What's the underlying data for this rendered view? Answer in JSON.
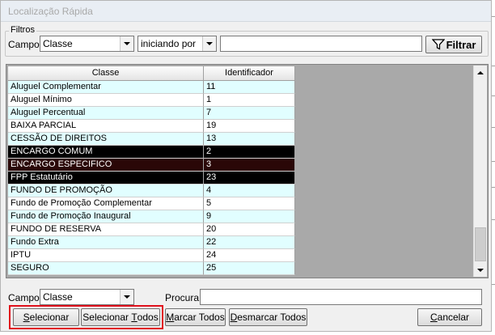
{
  "window": {
    "title": "Localização Rápida"
  },
  "filters": {
    "legend": "Filtros",
    "campo_label": "Campo:",
    "campo_value": "Classe",
    "mode_value": "iniciando por",
    "search_value": "",
    "filter_button": "Filtrar"
  },
  "grid": {
    "headers": [
      "Classe",
      "Identificador"
    ],
    "rows": [
      {
        "classe": "Aluguel Complementar",
        "id": "11",
        "style": "cyan"
      },
      {
        "classe": "Aluguel Mínimo",
        "id": "1",
        "style": "white"
      },
      {
        "classe": "Aluguel Percentual",
        "id": "7",
        "style": "cyan"
      },
      {
        "classe": "BAIXA PARCIAL",
        "id": "19",
        "style": "white"
      },
      {
        "classe": "CESSÃO DE DIREITOS",
        "id": "13",
        "style": "cyan"
      },
      {
        "classe": "ENCARGO COMUM",
        "id": "2",
        "style": "selected"
      },
      {
        "classe": "ENCARGO ESPECIFICO",
        "id": "3",
        "style": "selected-focus"
      },
      {
        "classe": "FPP Estatutário",
        "id": "23",
        "style": "selected"
      },
      {
        "classe": "FUNDO DE PROMOÇÃO",
        "id": "4",
        "style": "cyan"
      },
      {
        "classe": "Fundo de Promoção Complementar",
        "id": "5",
        "style": "white"
      },
      {
        "classe": "Fundo de Promoção Inaugural",
        "id": "9",
        "style": "cyan"
      },
      {
        "classe": "FUNDO DE RESERVA",
        "id": "20",
        "style": "white"
      },
      {
        "classe": "Fundo Extra",
        "id": "22",
        "style": "cyan"
      },
      {
        "classe": "IPTU",
        "id": "24",
        "style": "white"
      },
      {
        "classe": "SEGURO",
        "id": "25",
        "style": "cyan"
      }
    ]
  },
  "bottom": {
    "campo_label": "Campo:",
    "campo_value": "Classe",
    "procura_label": "Procura:",
    "procura_value": ""
  },
  "buttons": {
    "selecionar": {
      "pre": "",
      "u": "S",
      "post": "elecionar"
    },
    "selecionar_todos": {
      "pre": "Selecionar ",
      "u": "T",
      "post": "odos"
    },
    "marcar_todos": {
      "pre": "",
      "u": "M",
      "post": "arcar Todos"
    },
    "desmarcar_todos": {
      "pre": "",
      "u": "D",
      "post": "esmarcar Todos"
    },
    "cancelar": {
      "pre": "",
      "u": "C",
      "post": "ancelar"
    }
  },
  "colors": {
    "row_cyan": "#e1feff",
    "row_white": "#ffffff",
    "row_selected": "#000000",
    "row_selected_focus": "#2a0707",
    "highlight": "#e0101c"
  }
}
